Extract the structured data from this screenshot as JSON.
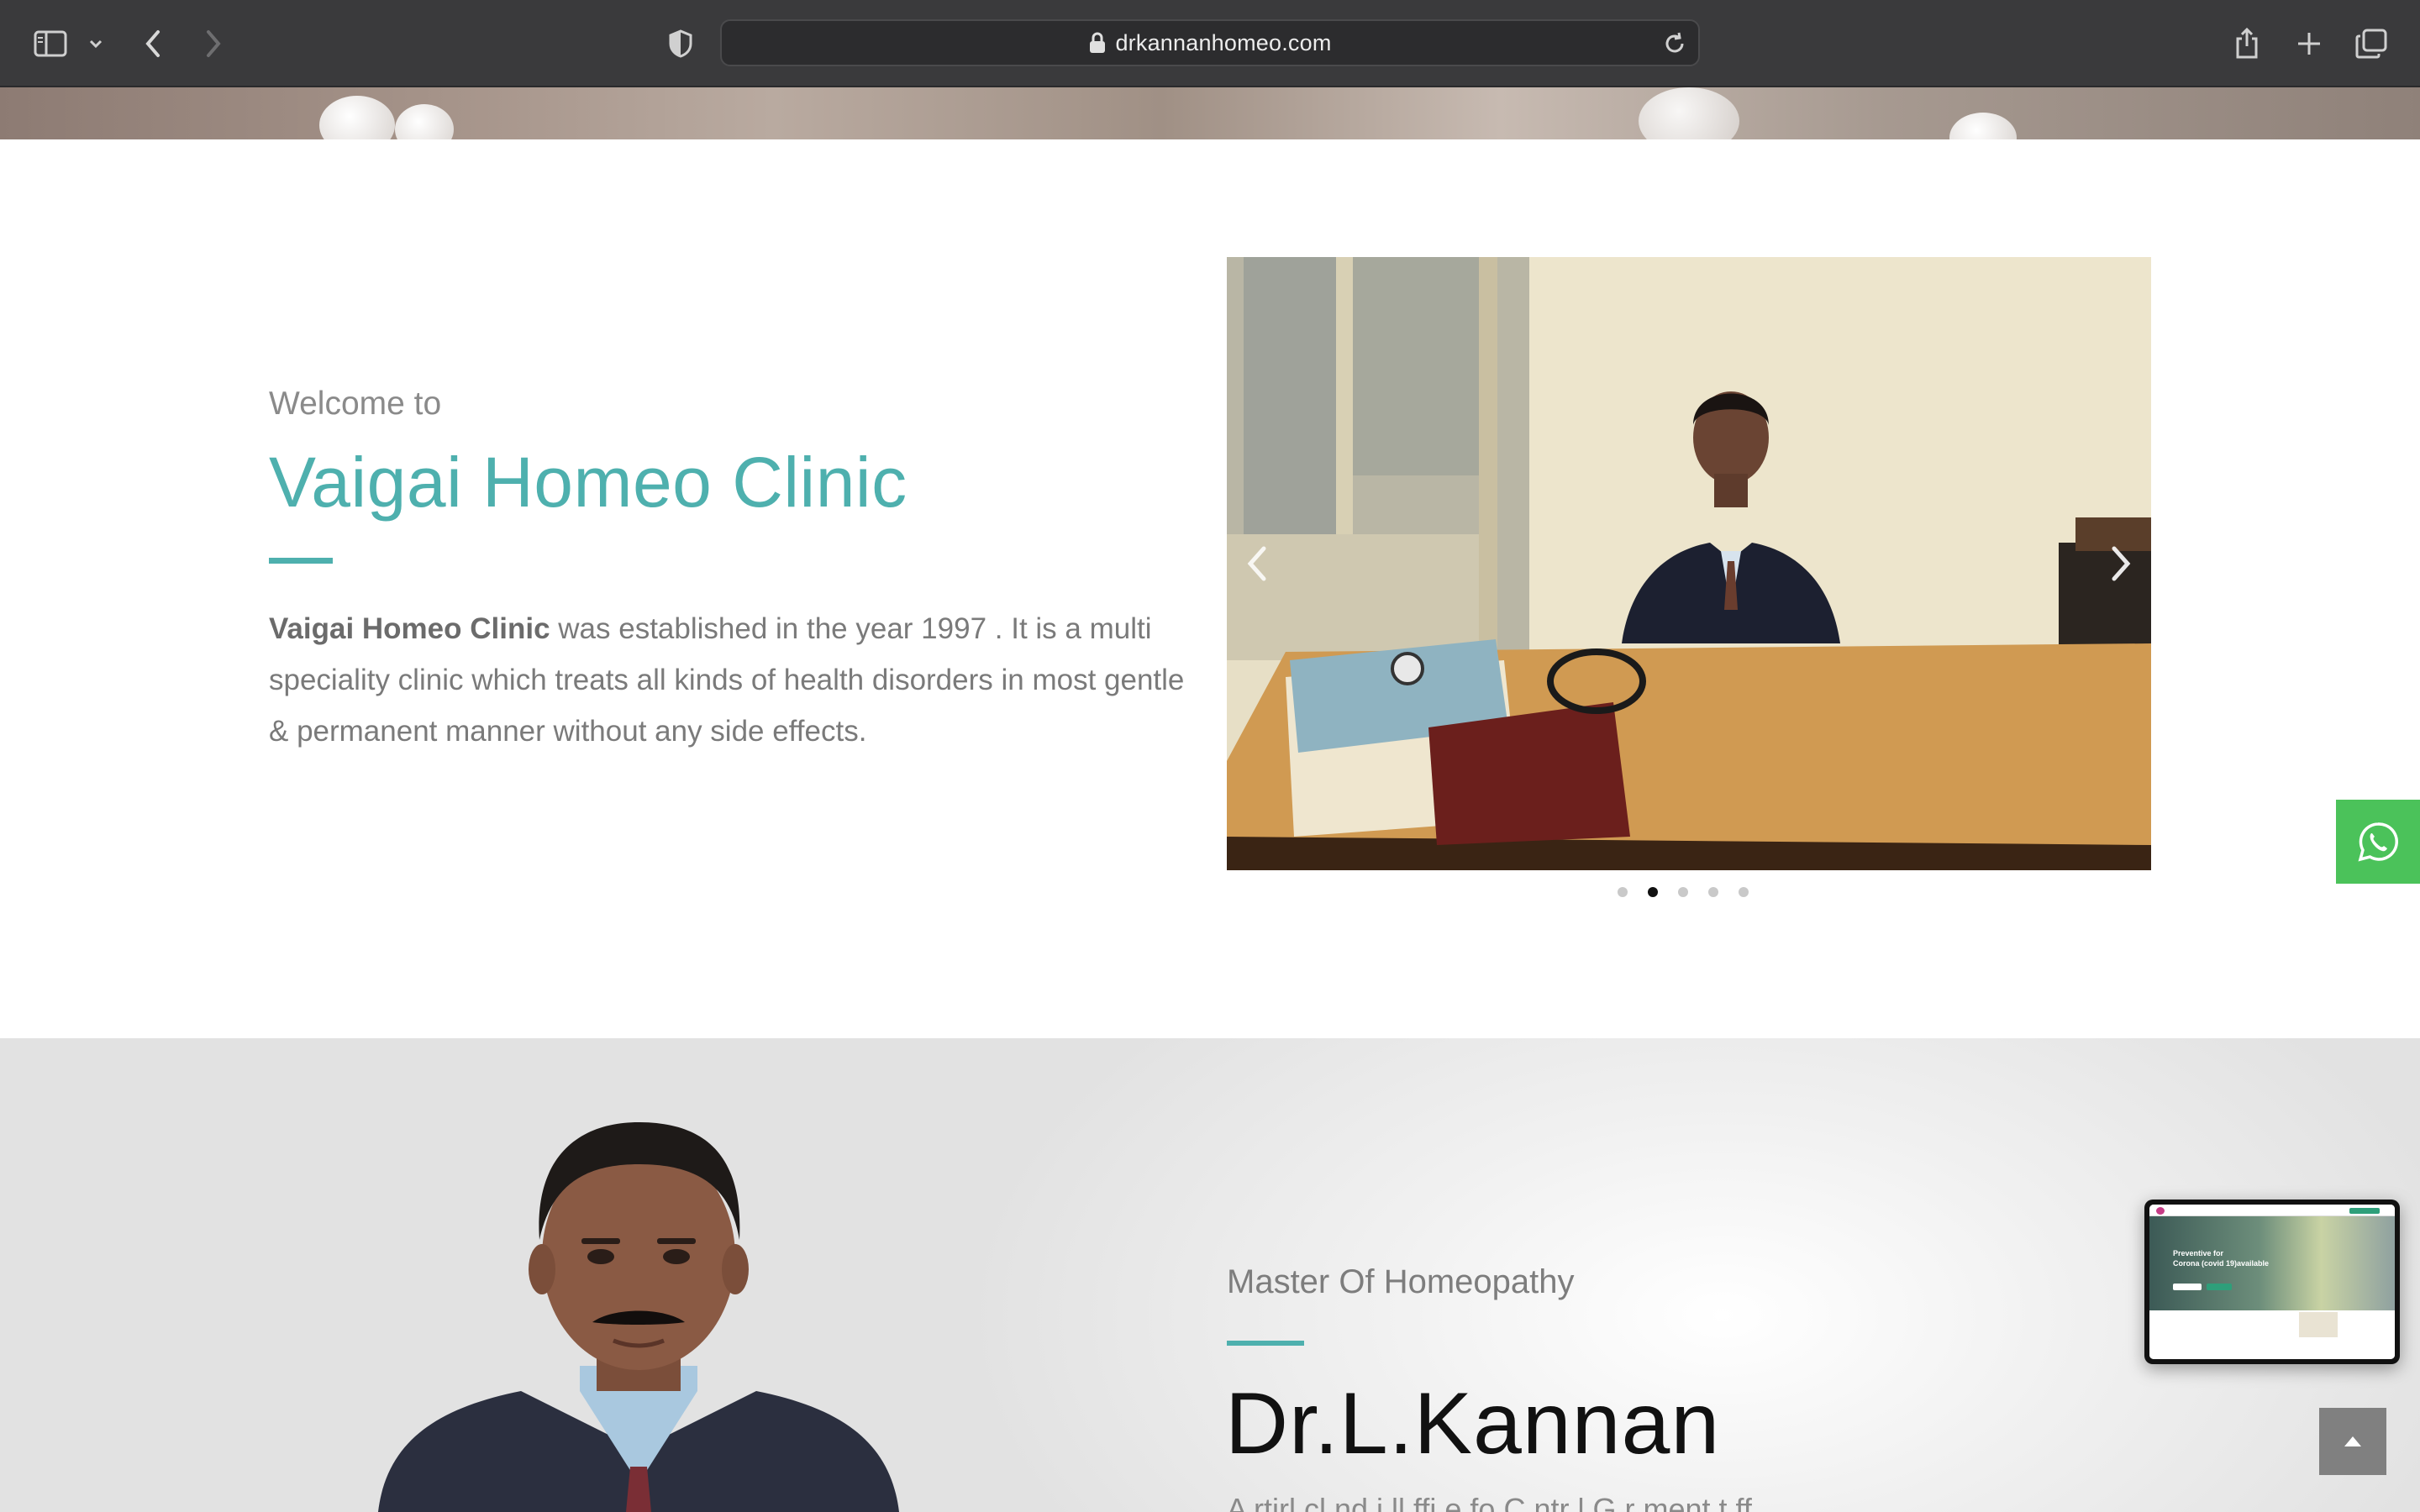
{
  "browser": {
    "url": "drkannanhomeo.com"
  },
  "welcome": {
    "pre_title": "Welcome to",
    "title": "Vaigai Homeo Clinic",
    "body_bold": "Vaigai Homeo Clinic",
    "body_rest": " was established in the year 1997 . It is a multi speciality clinic which treats all kinds of health disorders in most gentle & permanent manner without any side effects."
  },
  "carousel": {
    "slide_count": 5,
    "active_slide": 2
  },
  "doctor": {
    "subtitle": "Master Of Homeopathy",
    "name": "Dr.L.Kannan",
    "cut_text": "A rtirl cl nd i ll ffi e fo C ntr l G r ment t ff"
  },
  "pip_preview": {
    "headline_line1": "Preventive for",
    "headline_line2": "Corona (covid 19)available"
  },
  "colors": {
    "accent": "#4eb0ae",
    "whatsapp": "#4bc25a",
    "chrome": "#3a3a3c"
  }
}
